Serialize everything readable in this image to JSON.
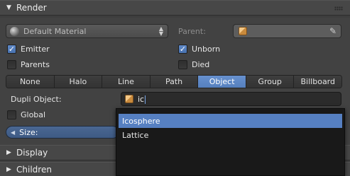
{
  "render_panel": {
    "title": "Render",
    "material": "Default Material",
    "parent_label": "Parent:",
    "parent_value": "",
    "checkboxes": {
      "emitter": {
        "label": "Emitter",
        "checked": true
      },
      "unborn": {
        "label": "Unborn",
        "checked": true
      },
      "parents": {
        "label": "Parents",
        "checked": false
      },
      "died": {
        "label": "Died",
        "checked": false
      },
      "global": {
        "label": "Global",
        "checked": false
      }
    },
    "render_types": [
      "None",
      "Halo",
      "Line",
      "Path",
      "Object",
      "Group",
      "Billboard"
    ],
    "active_render_type": "Object",
    "dupli_label": "Dupli Object:",
    "dupli_value": "ic",
    "size_label": "Size:"
  },
  "dropdown": {
    "items": [
      "Icosphere",
      "Lattice"
    ],
    "highlighted": "Icosphere"
  },
  "collapsed_panels": [
    "Display",
    "Children"
  ],
  "colors": {
    "accent": "#5680be",
    "panel_bg": "#424242",
    "header_bg": "#474747"
  }
}
